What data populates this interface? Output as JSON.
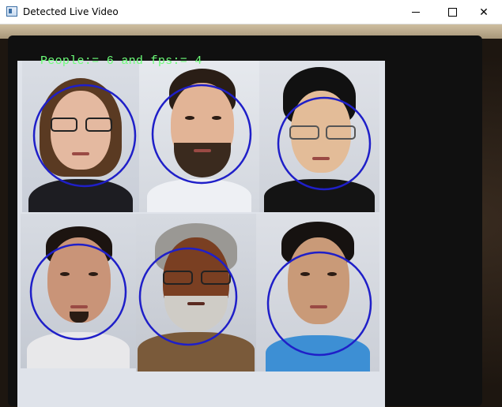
{
  "window": {
    "title": "Detected Live Video",
    "controls": {
      "minimize": "minimize",
      "maximize": "maximize",
      "close": "✕"
    }
  },
  "hud": {
    "label": "People:= 6 and fps:= 4",
    "color": "#6dff7a"
  },
  "detections": {
    "count": 6,
    "circle_color": "#1f1fc8"
  }
}
